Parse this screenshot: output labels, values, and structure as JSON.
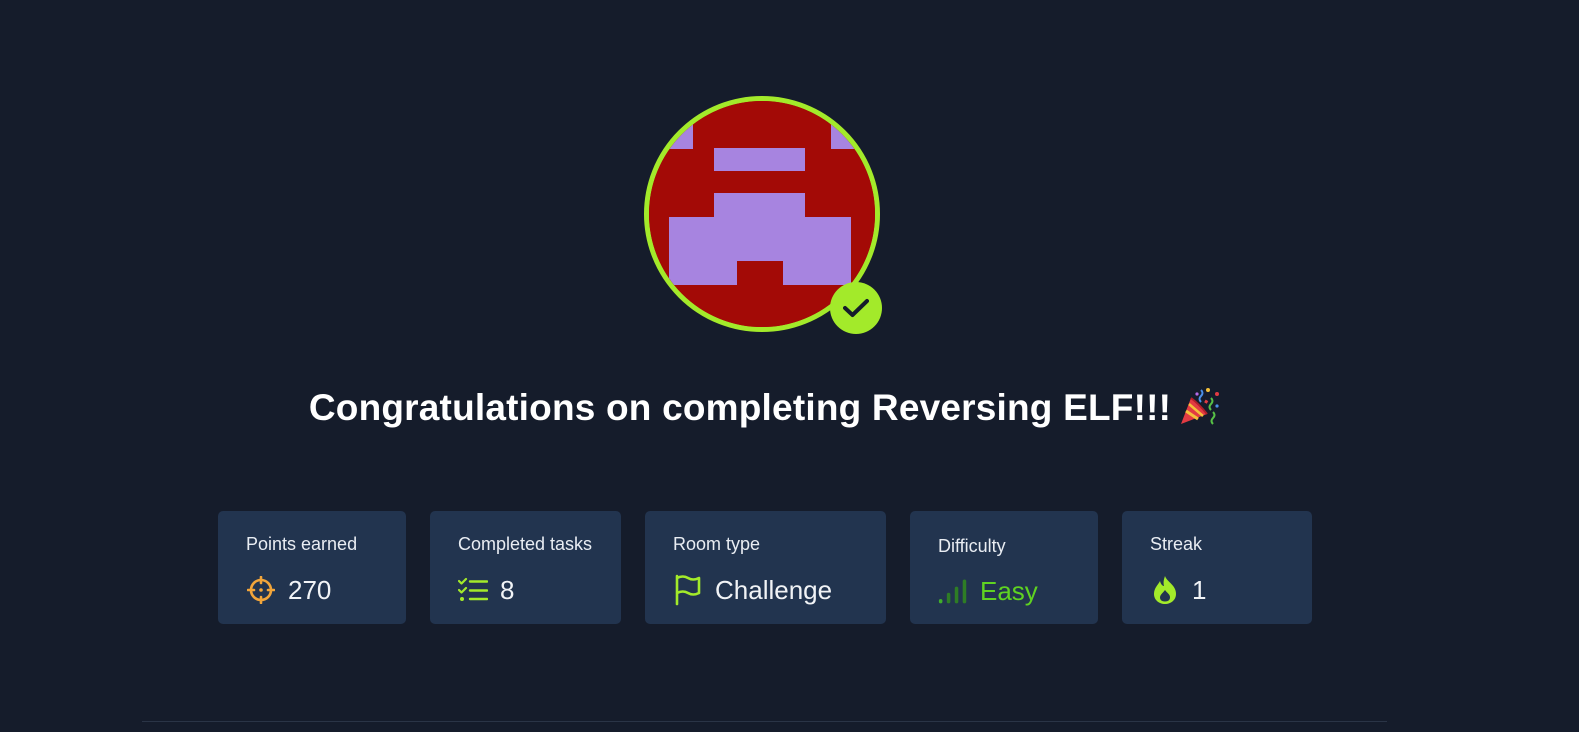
{
  "completion": {
    "title": "Congratulations on completing Reversing ELF!!!",
    "title_emoji": "party-popper-icon",
    "avatar": "room-avatar-pixel-invader",
    "badge_icon": "check-icon"
  },
  "stats": [
    {
      "label": "Points earned",
      "value": "270",
      "icon": "crosshair-icon",
      "icon_color": "#f2a53a"
    },
    {
      "label": "Completed tasks",
      "value": "8",
      "icon": "checklist-icon",
      "icon_color": "#a3ea2a"
    },
    {
      "label": "Room type",
      "value": "Challenge",
      "icon": "flag-icon",
      "icon_color": "#a3ea2a"
    },
    {
      "label": "Difficulty",
      "value": "Easy",
      "icon": "signal-bars-icon",
      "icon_color": "#3fae2a"
    },
    {
      "label": "Streak",
      "value": "1",
      "icon": "flame-icon",
      "icon_color": "#a3ea2a"
    }
  ],
  "colors": {
    "background": "#151c2b",
    "card": "#22344f",
    "accent": "#a3ea2a",
    "avatar_red": "#a30a06",
    "avatar_purple": "#a784e0",
    "easy": "#5fd321"
  }
}
